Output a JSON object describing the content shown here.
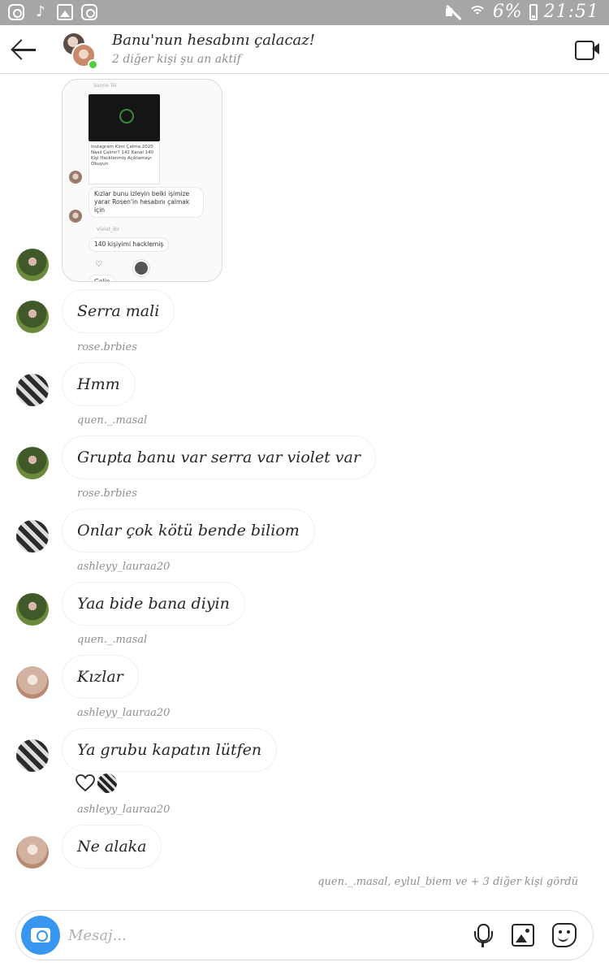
{
  "status_bar": {
    "left_icons": [
      "instagram-icon",
      "tiktok-icon",
      "gallery-icon",
      "instagram-icon"
    ],
    "battery": "6%",
    "time": "21:51"
  },
  "header": {
    "title": "Banu'nun hesabını çalacaz!",
    "subtitle": "2 diğer kişi şu an aktif"
  },
  "shared_post": {
    "caption_text": "Instagram Kimi Çalma 2020 Nasıl Çalınır? 142 Kanal 140 Kişi Hacklenmiş Açıklamayı Okuyun",
    "msg1": "Kızlar bunu izleyin belki işimize yarar Rosen'in hesabını çalmak için",
    "sender_label": "Violet_Bir",
    "msg2": "140 kişiyimi hacklemiş",
    "msg3": "Gelin"
  },
  "messages": [
    {
      "text": "Serra mali",
      "avatar": "green",
      "username": "quen._.masal"
    },
    {
      "text": "Hmm",
      "avatar": "bw",
      "username": "rose.brbies"
    },
    {
      "text": "Grupta banu var serra var violet var",
      "avatar": "green",
      "username": "quen._.masal"
    },
    {
      "text": "Onlar çok kötü bende biliom",
      "avatar": "bw",
      "username": "rose.brbies"
    },
    {
      "text": "Yaa bide bana diyin",
      "avatar": "green",
      "username": "ashleyy_lauraa20"
    },
    {
      "text": "Kızlar",
      "avatar": "skin",
      "username": "quen._.masal"
    },
    {
      "text": "Ya grubu kapatın lütfen",
      "avatar": "bw",
      "username": "ashleyy_lauraa20"
    },
    {
      "text": "Ne alaka",
      "avatar": "skin",
      "username": ""
    }
  ],
  "seen_text": "quen._.masal, eylul_biem ve + 3 diğer kişi gördü",
  "composer": {
    "placeholder": "Mesaj..."
  },
  "colors": {
    "accent": "#3897f0",
    "online": "#4cd137",
    "status_bar": "#a6a6a6"
  }
}
